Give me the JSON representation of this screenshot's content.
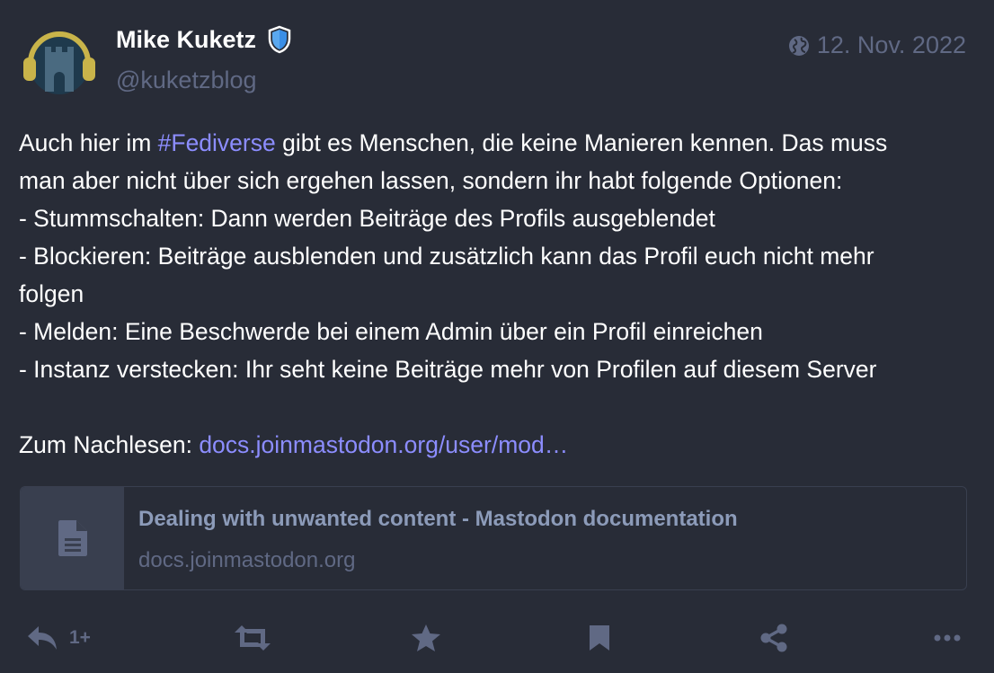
{
  "author": {
    "display_name": "Mike Kuketz",
    "handle": "@kuketzblog"
  },
  "timestamp": "12. Nov. 2022",
  "content": {
    "line1_before": "Auch hier im ",
    "hashtag": "#Fediverse",
    "line1_after": " gibt es Menschen, die keine Manieren kennen. Das muss",
    "line2": "man aber nicht über sich ergehen lassen, sondern ihr habt folgende Optionen:",
    "line3": "- Stummschalten: Dann werden Beiträge des Profils ausgeblendet",
    "line4": "- Blockieren: Beiträge ausblenden und zusätzlich kann das Profil euch nicht mehr",
    "line5": "folgen",
    "line6": "- Melden: Eine Beschwerde bei einem Admin über ein Profil einreichen",
    "line7": "- Instanz verstecken: Ihr seht keine Beiträge mehr von Profilen auf diesem Server",
    "read_more_prefix": "Zum Nachlesen: ",
    "link_text": "docs.joinmastodon.org/user/mod…"
  },
  "card": {
    "title": "Dealing with unwanted content - Mastodon documentation",
    "host": "docs.joinmastodon.org",
    "thumb_icon": "document-icon"
  },
  "actions": {
    "reply_count": "1+",
    "icons": [
      "reply-icon",
      "boost-icon",
      "favourite-icon",
      "bookmark-icon",
      "share-icon",
      "more-icon"
    ]
  },
  "colors": {
    "background": "#282c37",
    "text": "#ffffff",
    "muted": "#606984",
    "link": "#8c8dff",
    "card_title": "#8c9bb9",
    "card_thumb": "#393f4f",
    "verified": "#3a8ee6"
  }
}
